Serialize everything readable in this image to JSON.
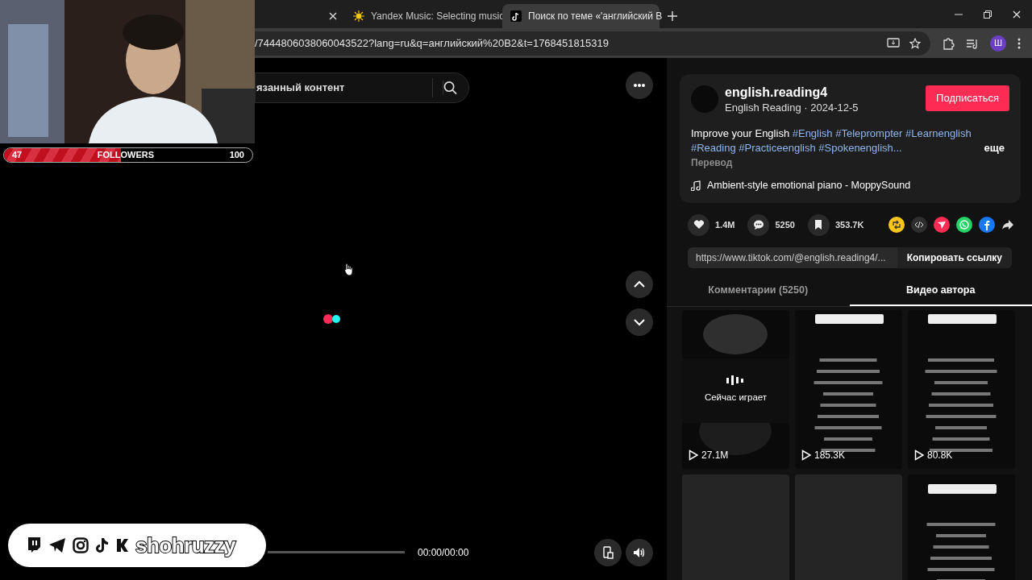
{
  "browser": {
    "tabs": [
      {
        "selected": false
      },
      {
        "title": "Yandex Music: Selecting music",
        "selected": false
      },
      {
        "title": "Поиск по теме «'английский В",
        "selected": true
      }
    ],
    "address": "/7444806038060043522?lang=ru&q=английский%20B2&t=1768451815319",
    "profile": "Ш"
  },
  "video": {
    "search_value": "язанный контент",
    "time": "00:00/00:00"
  },
  "post": {
    "author": "english.reading4",
    "subtitle": "English Reading · 2024-12-5",
    "follow": "Подписаться",
    "description": "Improve your English",
    "hashtags": [
      "#English",
      "#Teleprompter",
      "#Learnenglish",
      "#Reading",
      "#Practiceenglish",
      "#Spokenenglish..."
    ],
    "more": "еще",
    "translate": "Перевод",
    "music": "Ambient-style emotional piano - MoppySound",
    "stats": [
      {
        "kind": "like",
        "count": "1.4M"
      },
      {
        "kind": "comment",
        "count": "5250"
      },
      {
        "kind": "bookmark",
        "count": "353.7K"
      }
    ],
    "share": [
      {
        "kind": "repost",
        "color": "#fcc51a"
      },
      {
        "kind": "embed",
        "color": "#2f2f2f"
      },
      {
        "kind": "send",
        "color": "#fe2c55"
      },
      {
        "kind": "whatsapp",
        "color": "#25d366"
      },
      {
        "kind": "facebook",
        "color": "#1877f2"
      },
      {
        "kind": "forward"
      }
    ],
    "link": "https://www.tiktok.com/@english.reading4/...",
    "copy": "Копировать ссылку",
    "tabs": [
      {
        "label": "Комментарии (5250)",
        "selected": false
      },
      {
        "label": "Видео автора",
        "selected": true
      }
    ],
    "videos": [
      {
        "kind": "picture",
        "playing": true,
        "status": "Сейчас играет",
        "views": "27.1M"
      },
      {
        "kind": "picture",
        "playing": false,
        "views": "185.3K"
      },
      {
        "kind": "picture",
        "playing": false,
        "views": "80.8K"
      },
      {
        "kind": "empty"
      },
      {
        "kind": "empty"
      },
      {
        "kind": "picture"
      }
    ]
  },
  "stream_overlay": {
    "followers": {
      "current": "47",
      "label": "FOLLOWERS",
      "goal": "100",
      "level": 0.47
    },
    "handle": "shohruzzy"
  }
}
